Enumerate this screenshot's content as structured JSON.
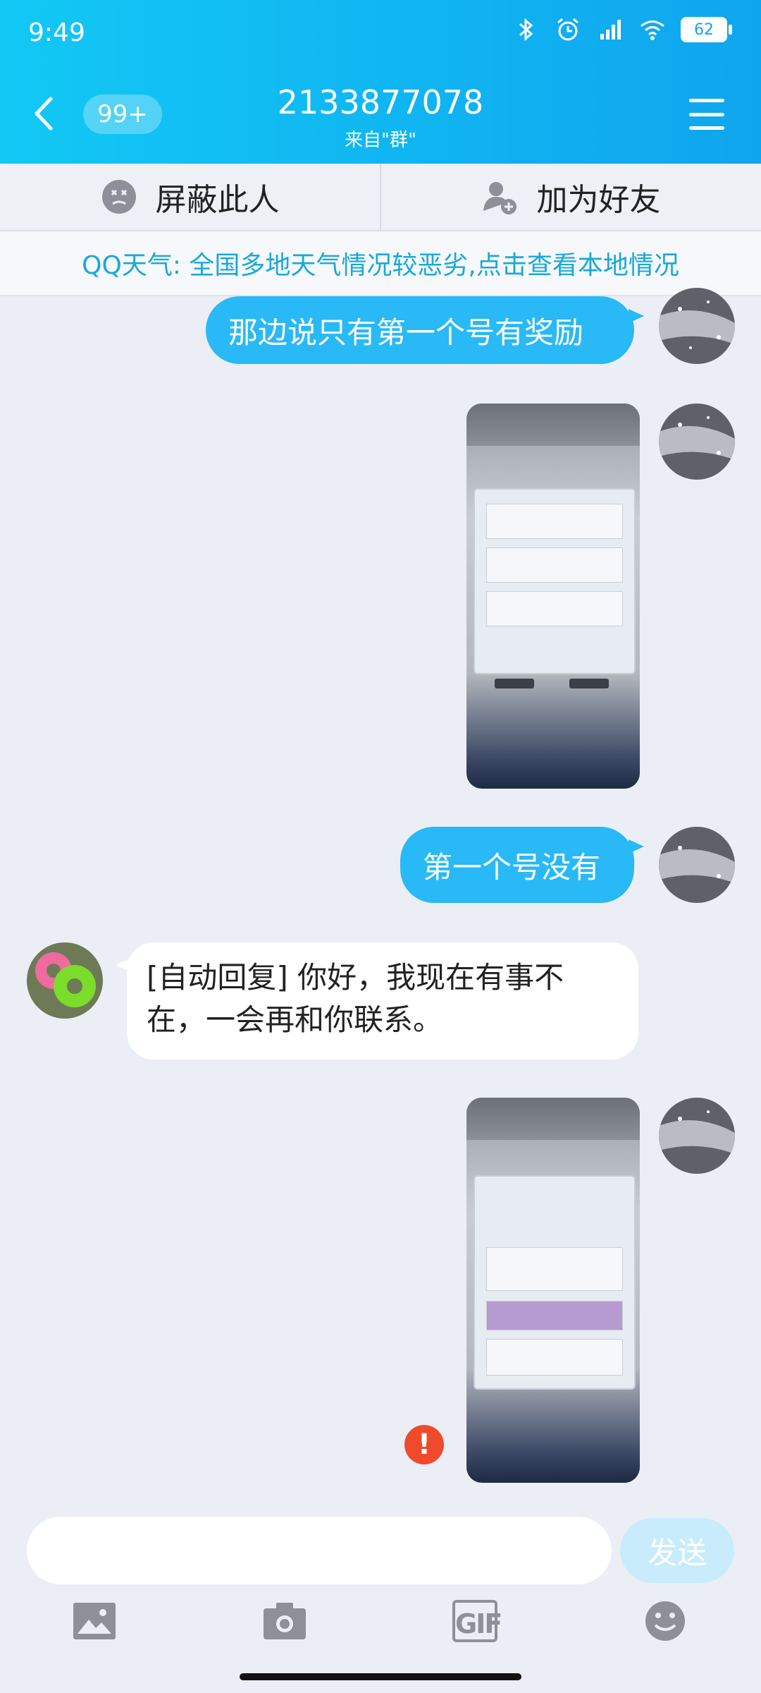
{
  "status_bar": {
    "time": "9:49",
    "battery": "62"
  },
  "header": {
    "unread_count": "99+",
    "title": "2133877078",
    "subtitle": "来自\"群\""
  },
  "actions": {
    "block_label": "屏蔽此人",
    "add_friend_label": "加为好友"
  },
  "notice": {
    "text": "QQ天气: 全国多地天气情况较恶劣,点击查看本地情况"
  },
  "messages": [
    {
      "direction": "out",
      "type": "text",
      "text": "那边说只有第一个号有奖励"
    },
    {
      "direction": "out",
      "type": "image",
      "image": "game-mail-screenshot"
    },
    {
      "direction": "out",
      "type": "text",
      "text": "第一个号没有"
    },
    {
      "direction": "in",
      "type": "text",
      "text": "[自动回复] 你好，我现在有事不在，一会再和你联系。"
    },
    {
      "direction": "out",
      "type": "image",
      "image": "game-profile-screenshot",
      "status": "failed"
    }
  ],
  "input": {
    "placeholder": "",
    "value": "",
    "send_label": "发送"
  },
  "toolbar": {
    "items": [
      "image-icon",
      "camera-icon",
      "gif-icon",
      "emoji-icon"
    ],
    "gif_label": "GIF"
  },
  "colors": {
    "header": "#0fa5ee",
    "bubble_out": "#28b9f6",
    "notice_text": "#17a9d8",
    "error": "#f04a2c"
  }
}
